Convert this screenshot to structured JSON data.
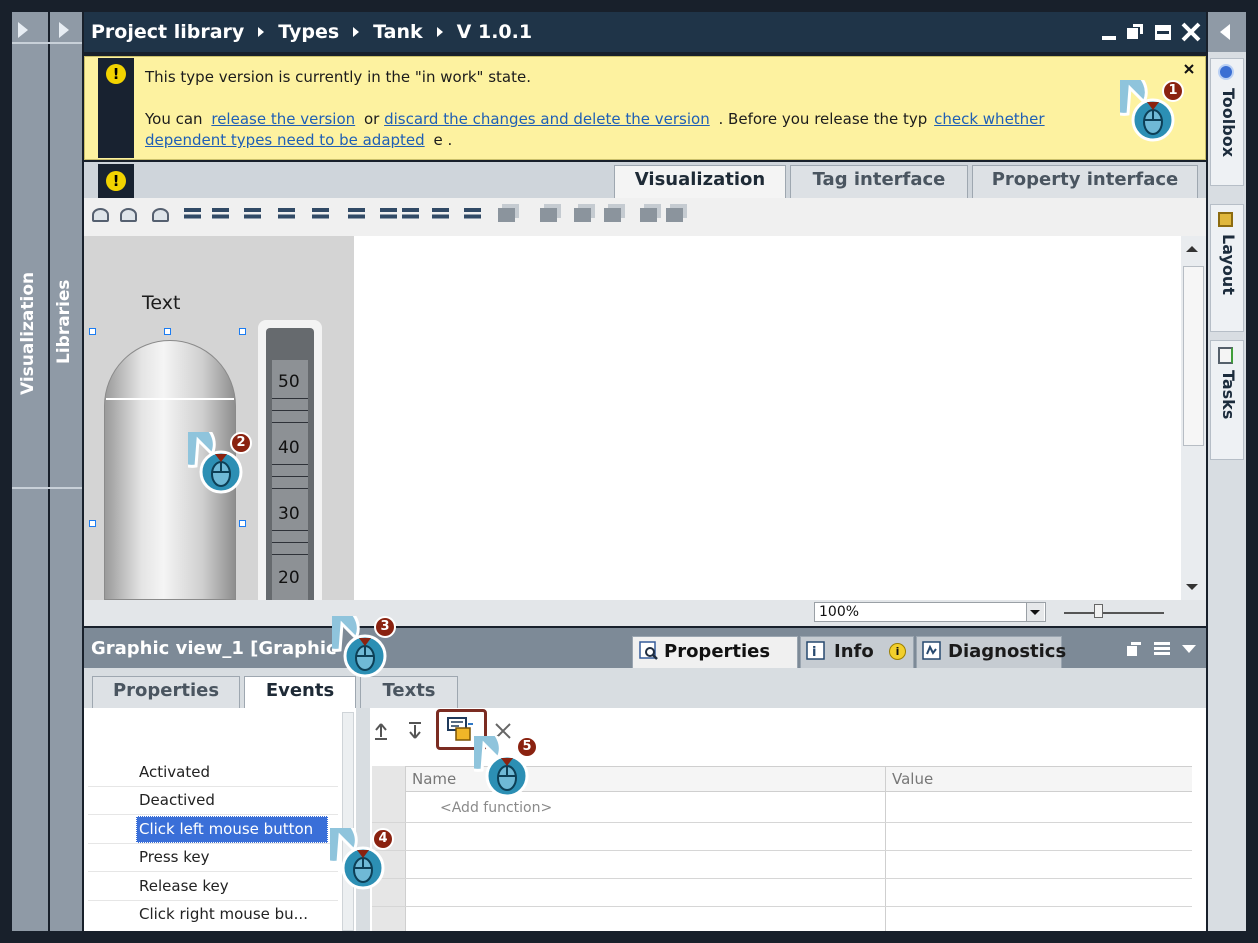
{
  "titlebar": {
    "breadcrumb": [
      "Project library",
      "Types",
      "Tank",
      "V 1.0.1"
    ],
    "controls": [
      "minimize-icon",
      "float-icon",
      "maximize-icon",
      "close-icon"
    ]
  },
  "left_sidebars": {
    "visualization": "Visualization",
    "libraries": "Libraries"
  },
  "right_sidebar": {
    "tabs": [
      {
        "label": "Toolbox",
        "icon": "toolbox-icon"
      },
      {
        "label": "Layout",
        "icon": "layout-icon"
      },
      {
        "label": "Tasks",
        "icon": "tasks-icon"
      }
    ]
  },
  "banner": {
    "line1": "This type version is currently in the \"in work\" state.",
    "p_you_can": "You can",
    "link_release": "release the version",
    "p_or": "or",
    "link_discard": "discard the changes and delete the version",
    "p_before": ". Before you release the typ",
    "link_check1": "check whether",
    "link_check2": "dependent types need to be adapted",
    "p_end": "e ."
  },
  "editor_tabs": [
    {
      "label": "Visualization",
      "active": true
    },
    {
      "label": "Tag interface",
      "active": false
    },
    {
      "label": "Property interface",
      "active": false
    }
  ],
  "canvas": {
    "object_text": "Text",
    "scale_labels": [
      "50",
      "40",
      "30",
      "20"
    ],
    "zoom": "100%"
  },
  "inspector": {
    "title": "Graphic view_1 [Graphic",
    "top_tabs": [
      {
        "label": "Properties",
        "icon": "properties-icon"
      },
      {
        "label": "Info",
        "icon": "info-icon"
      },
      {
        "label": "Diagnostics",
        "icon": "diagnostics-icon"
      }
    ],
    "sub_tabs": [
      {
        "label": "Properties",
        "active": false
      },
      {
        "label": "Events",
        "active": true
      },
      {
        "label": "Texts",
        "active": false
      }
    ],
    "events": [
      "Activated",
      "Deactived",
      "Click left mouse button",
      "Press key",
      "Release key",
      "Click right mouse bu..."
    ],
    "selected_event": "Click left mouse button",
    "grid": {
      "columns": [
        "Name",
        "Value"
      ],
      "placeholder": "<Add function>"
    }
  },
  "markers": [
    "1",
    "2",
    "3",
    "4",
    "5"
  ],
  "colors": {
    "frame": "#18202b",
    "sidebar": "#8f9aa6",
    "title_bg": "#1f3448",
    "banner": "#fdf2a0",
    "selection": "#3a6fd8",
    "marker": "#2c8fb4",
    "badge": "#8a2210"
  }
}
